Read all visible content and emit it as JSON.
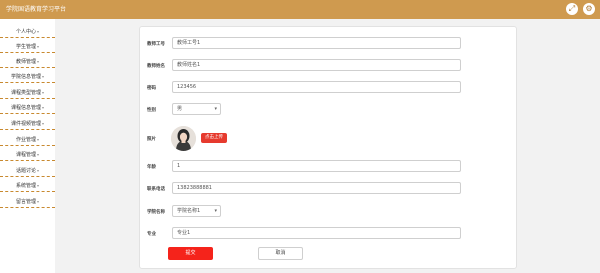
{
  "header": {
    "title": "学院国语教育学习平台",
    "fullscreen_icon": "fullscreen-icon",
    "user_icon": "user-menu-icon",
    "accent": "#cf9a4f"
  },
  "sidebar": {
    "items": [
      {
        "label": "个人中心"
      },
      {
        "label": "学生管理"
      },
      {
        "label": "教师管理"
      },
      {
        "label": "学院信息管理"
      },
      {
        "label": "课程类型管理"
      },
      {
        "label": "课程信息管理"
      },
      {
        "label": "课件视频管理"
      },
      {
        "label": "作业管理"
      },
      {
        "label": "课程管理"
      },
      {
        "label": "话题讨论"
      },
      {
        "label": "系统管理"
      },
      {
        "label": "留言管理"
      }
    ]
  },
  "form": {
    "teacher_id_label": "教师工号",
    "teacher_id_value": "教师工号1",
    "teacher_name_label": "教师姓名",
    "teacher_name_value": "教师姓名1",
    "password_label": "密码",
    "password_value": "123456",
    "gender_label": "性别",
    "gender_value": "男",
    "photo_label": "照片",
    "upload_label": "点击上传",
    "age_label": "年龄",
    "age_value": "1",
    "phone_label": "联系电话",
    "phone_value": "13823888881",
    "college_label": "学院名称",
    "college_value": "学院名称1",
    "major_label": "专业",
    "major_value": "专业1",
    "submit_label": "提交",
    "cancel_label": "取消",
    "primary_color": "#f5231b"
  }
}
